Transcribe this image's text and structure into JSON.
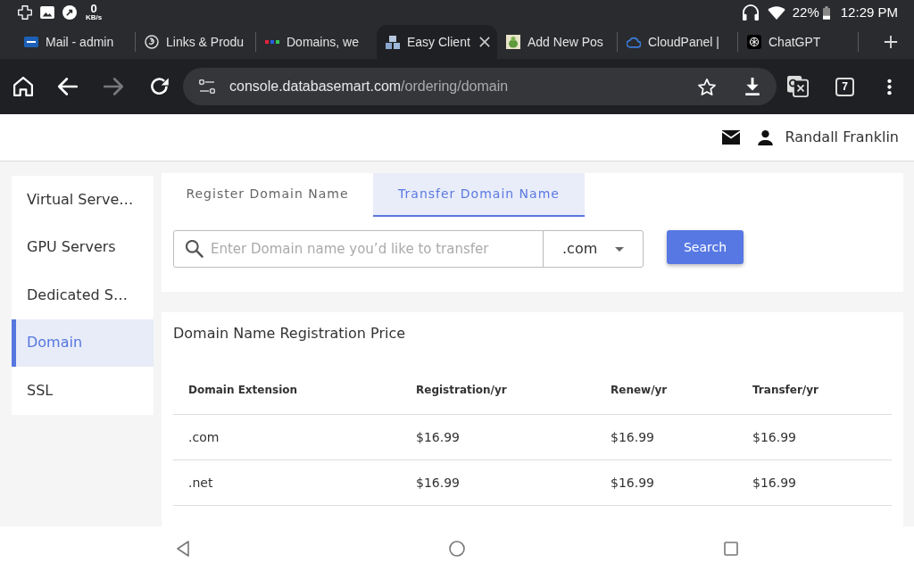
{
  "status_bar": {
    "network_speed": "0",
    "network_unit": "KB/s",
    "battery": "22%",
    "time": "12:29 PM"
  },
  "browser_tabs": [
    {
      "title": "Mail - admin",
      "selected": false
    },
    {
      "title": "Links & Produ",
      "selected": false
    },
    {
      "title": "Domains, we",
      "selected": false
    },
    {
      "title": "Easy Client",
      "selected": true
    },
    {
      "title": "Add New Pos",
      "selected": false
    },
    {
      "title": "CloudPanel |",
      "selected": false
    },
    {
      "title": "ChatGPT",
      "selected": false
    }
  ],
  "address_bar": {
    "host": "console.databasemart.com",
    "path": "/ordering/domain"
  },
  "toolbar": {
    "tab_count": "7"
  },
  "header": {
    "user_name": "Randall Franklin"
  },
  "sidebar": {
    "items": [
      {
        "label": "Virtual Serve…",
        "selected": false
      },
      {
        "label": "GPU Servers",
        "selected": false
      },
      {
        "label": "Dedicated S…",
        "selected": false
      },
      {
        "label": "Domain",
        "selected": true
      },
      {
        "label": "SSL",
        "selected": false
      }
    ]
  },
  "search_panel": {
    "tabs": [
      {
        "label": "Register Domain Name",
        "selected": false
      },
      {
        "label": "Transfer Domain Name",
        "selected": true
      }
    ],
    "placeholder": "Enter Domain name you’d like to transfer",
    "extension": ".com",
    "button": "Search"
  },
  "price_table": {
    "title": "Domain Name Registration Price",
    "columns": [
      "Domain Extension",
      "Registration/yr",
      "Renew/yr",
      "Transfer/yr"
    ],
    "rows": [
      [
        ".com",
        "$16.99",
        "$16.99",
        "$16.99"
      ],
      [
        ".net",
        "$16.99",
        "$16.99",
        "$16.99"
      ]
    ]
  }
}
